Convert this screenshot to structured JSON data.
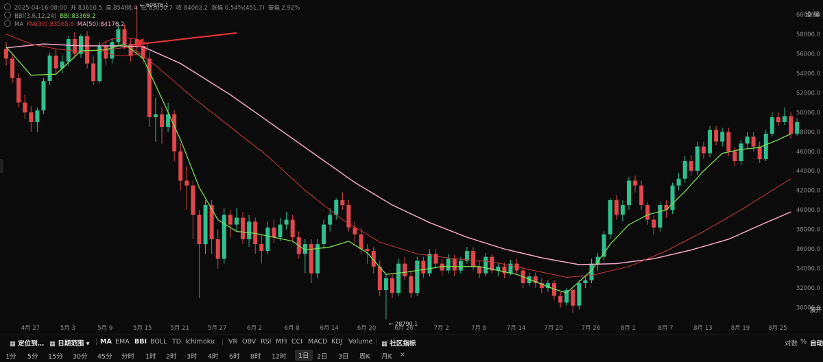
{
  "info": {
    "line1": {
      "time": "2025-04-16 08:00",
      "open": "开 83610.5",
      "high": "高 85488.4",
      "low": "低 83050.7",
      "close": "收 84062.2",
      "change": "涨幅 0.54%(451.7)",
      "amplitude": "振幅 2.92%"
    },
    "line2": {
      "name": "BBI(3,6,12,24)",
      "value": "BBI:83369.2"
    },
    "line3": {
      "name": "MA",
      "ma30": "MA(30):83565.6",
      "ma50": "MA(50):84176.2"
    }
  },
  "topright": "设 编",
  "expand_label": "展开",
  "colors": {
    "up": "#2fbf8f",
    "down": "#e0474c",
    "bbi": "#7fe054",
    "ma30": "#d03a3a",
    "ma50": "#f2a8c8",
    "arrow": "#e23333"
  },
  "chart_data": {
    "type": "candlestick",
    "ylim": [
      28500,
      61500
    ],
    "yticks": [
      "30000.0",
      "32000.0",
      "34000.0",
      "36000.0",
      "38000.0",
      "40000.0",
      "42000.0",
      "44000.0",
      "46000.0",
      "48000.0",
      "50000.0",
      "52000.0",
      "54000.0",
      "56000.0",
      "58000.0",
      "60000.0"
    ],
    "xticks": [
      {
        "label": "4月 27",
        "i": 4
      },
      {
        "label": "5月 3",
        "i": 10
      },
      {
        "label": "5月 9",
        "i": 16
      },
      {
        "label": "5月 15",
        "i": 22
      },
      {
        "label": "5月 21",
        "i": 28
      },
      {
        "label": "5月 27",
        "i": 34
      },
      {
        "label": "6月 2",
        "i": 40
      },
      {
        "label": "6月 8",
        "i": 46
      },
      {
        "label": "6月 14",
        "i": 52
      },
      {
        "label": "6月 20",
        "i": 58
      },
      {
        "label": "6月 26",
        "i": 64
      },
      {
        "label": "7月 2",
        "i": 70
      },
      {
        "label": "7月 8",
        "i": 76
      },
      {
        "label": "7月 14",
        "i": 82
      },
      {
        "label": "7月 20",
        "i": 88
      },
      {
        "label": "7月 26",
        "i": 94
      },
      {
        "label": "8月 1",
        "i": 100
      },
      {
        "label": "8月 7",
        "i": 106
      },
      {
        "label": "8月 13",
        "i": 112
      },
      {
        "label": "8月 19",
        "i": 118
      },
      {
        "label": "8月 25",
        "i": 124
      }
    ],
    "annotations": [
      {
        "text": "60876.1",
        "i": 21,
        "value": 60876.1,
        "kind": "high"
      },
      {
        "text": "28790.1",
        "i": 61,
        "value": 28790.1,
        "kind": "low"
      }
    ],
    "candles": [
      [
        56500,
        55500,
        57200,
        54800
      ],
      [
        55500,
        53500,
        56000,
        53000
      ],
      [
        53500,
        51000,
        54000,
        50500
      ],
      [
        51000,
        50000,
        51800,
        49300
      ],
      [
        50000,
        49000,
        50600,
        48000
      ],
      [
        49000,
        50200,
        50500,
        48000
      ],
      [
        50200,
        53200,
        53500,
        49800
      ],
      [
        53200,
        55800,
        56100,
        52800
      ],
      [
        55800,
        54500,
        56500,
        54000
      ],
      [
        54500,
        55200,
        55800,
        54000
      ],
      [
        55200,
        57500,
        57800,
        54800
      ],
      [
        57500,
        56000,
        58200,
        55500
      ],
      [
        56000,
        57800,
        58000,
        55600
      ],
      [
        57800,
        55000,
        58300,
        54500
      ],
      [
        55000,
        53200,
        55800,
        52800
      ],
      [
        53200,
        56800,
        57200,
        53000
      ],
      [
        56800,
        55500,
        57200,
        54800
      ],
      [
        55500,
        57200,
        57600,
        55000
      ],
      [
        57200,
        58500,
        59200,
        56800
      ],
      [
        58500,
        57000,
        59000,
        56500
      ],
      [
        57000,
        55800,
        57600,
        55200
      ],
      [
        57500,
        56800,
        60876,
        56000
      ],
      [
        56800,
        55500,
        57200,
        55000
      ],
      [
        55500,
        49500,
        56200,
        48500
      ],
      [
        49500,
        49800,
        51500,
        47000
      ],
      [
        49800,
        48500,
        50500,
        46800
      ],
      [
        48500,
        49800,
        51000,
        48000
      ],
      [
        49800,
        46000,
        50200,
        45000
      ],
      [
        46000,
        43000,
        46800,
        42000
      ],
      [
        43000,
        42500,
        44500,
        40000
      ],
      [
        42500,
        39500,
        43000,
        37000
      ],
      [
        39500,
        36500,
        40000,
        31000
      ],
      [
        36500,
        40500,
        41000,
        35500
      ],
      [
        40500,
        37000,
        41000,
        35500
      ],
      [
        37000,
        35000,
        38000,
        34000
      ],
      [
        35000,
        39500,
        40200,
        34500
      ],
      [
        39500,
        38500,
        40000,
        37200
      ],
      [
        38500,
        39200,
        40200,
        37800
      ],
      [
        39200,
        37000,
        39800,
        36500
      ],
      [
        37000,
        38800,
        39500,
        36200
      ],
      [
        38800,
        36500,
        39200,
        35500
      ],
      [
        36500,
        35800,
        37500,
        34500
      ],
      [
        35800,
        38200,
        38800,
        35500
      ],
      [
        38200,
        37200,
        39000,
        36600
      ],
      [
        37200,
        38500,
        39200,
        36800
      ],
      [
        38500,
        39000,
        39800,
        38000
      ],
      [
        39000,
        37200,
        39500,
        36800
      ],
      [
        37200,
        35500,
        37800,
        35000
      ],
      [
        35500,
        36500,
        37000,
        33500
      ],
      [
        36500,
        33500,
        37000,
        32500
      ],
      [
        33500,
        36500,
        37000,
        33000
      ],
      [
        36500,
        38500,
        39000,
        36000
      ],
      [
        38500,
        39500,
        40200,
        37800
      ],
      [
        39500,
        41000,
        41200,
        39000
      ],
      [
        41000,
        40500,
        41800,
        40000
      ],
      [
        40500,
        38200,
        41000,
        37800
      ],
      [
        38200,
        37500,
        38800,
        36500
      ],
      [
        37500,
        36000,
        38200,
        35500
      ],
      [
        36000,
        35800,
        36500,
        34500
      ],
      [
        35800,
        34200,
        36200,
        33500
      ],
      [
        34200,
        31800,
        34800,
        31200
      ],
      [
        31800,
        33000,
        33500,
        28790
      ],
      [
        33000,
        31500,
        33400,
        31000
      ],
      [
        31500,
        34500,
        35000,
        31200
      ],
      [
        34500,
        33200,
        35200,
        32800
      ],
      [
        33200,
        31500,
        33800,
        31000
      ],
      [
        31500,
        34800,
        35200,
        31200
      ],
      [
        34800,
        33500,
        35200,
        33000
      ],
      [
        33500,
        35500,
        36000,
        33200
      ],
      [
        35500,
        34500,
        36000,
        34000
      ],
      [
        34500,
        33800,
        35000,
        33200
      ],
      [
        33800,
        35000,
        35500,
        33500
      ],
      [
        35000,
        33800,
        35400,
        33200
      ],
      [
        33800,
        34800,
        35200,
        33500
      ],
      [
        34800,
        35800,
        36200,
        34500
      ],
      [
        35800,
        34200,
        36200,
        33800
      ],
      [
        34200,
        33500,
        34800,
        33000
      ],
      [
        33500,
        35200,
        35600,
        33200
      ],
      [
        35200,
        33800,
        35500,
        33500
      ],
      [
        33800,
        34200,
        34600,
        33200
      ],
      [
        34200,
        33500,
        34600,
        33000
      ],
      [
        33500,
        34500,
        34900,
        33300
      ],
      [
        34500,
        33800,
        35000,
        33500
      ],
      [
        33800,
        32500,
        34200,
        32000
      ],
      [
        32500,
        33200,
        33600,
        32200
      ],
      [
        33200,
        32500,
        33600,
        32000
      ],
      [
        32500,
        32000,
        33000,
        31500
      ],
      [
        32000,
        32500,
        32800,
        31600
      ],
      [
        32500,
        31200,
        32800,
        30800
      ],
      [
        31200,
        30500,
        31600,
        30000
      ],
      [
        30500,
        31800,
        32000,
        30200
      ],
      [
        31800,
        30200,
        32000,
        29500
      ],
      [
        30200,
        32500,
        32800,
        29800
      ],
      [
        32500,
        32800,
        33200,
        32000
      ],
      [
        32800,
        34500,
        35000,
        32500
      ],
      [
        34500,
        35200,
        35600,
        33800
      ],
      [
        35200,
        37500,
        37800,
        34800
      ],
      [
        37500,
        41000,
        41200,
        37000
      ],
      [
        41000,
        39500,
        41500,
        39000
      ],
      [
        39500,
        40500,
        41000,
        38800
      ],
      [
        40500,
        43000,
        43400,
        40000
      ],
      [
        43000,
        42500,
        43500,
        41800
      ],
      [
        42500,
        40500,
        43000,
        40000
      ],
      [
        40500,
        39000,
        40800,
        38500
      ],
      [
        39000,
        38200,
        39400,
        37500
      ],
      [
        38200,
        40500,
        40800,
        37800
      ],
      [
        40500,
        40000,
        41000,
        39200
      ],
      [
        40000,
        42500,
        42800,
        39600
      ],
      [
        42500,
        43200,
        43800,
        42000
      ],
      [
        43200,
        45000,
        45500,
        42800
      ],
      [
        45000,
        44000,
        45600,
        43500
      ],
      [
        44000,
        46500,
        47000,
        43600
      ],
      [
        46500,
        45800,
        47000,
        45200
      ],
      [
        45800,
        48200,
        48600,
        45400
      ],
      [
        48200,
        47000,
        48600,
        46600
      ],
      [
        47000,
        48000,
        48400,
        46500
      ],
      [
        48000,
        46000,
        48400,
        45500
      ],
      [
        46000,
        45000,
        46400,
        44500
      ],
      [
        45000,
        46800,
        47200,
        44600
      ],
      [
        46800,
        47500,
        48000,
        46300
      ],
      [
        47500,
        46500,
        48000,
        46000
      ],
      [
        46500,
        45200,
        47000,
        44800
      ],
      [
        45200,
        47800,
        48200,
        45000
      ],
      [
        47800,
        49500,
        50000,
        47500
      ],
      [
        49500,
        49000,
        50000,
        48600
      ],
      [
        49000,
        49600,
        50500,
        48700
      ],
      [
        49600,
        47800,
        50000,
        47300
      ],
      [
        47800,
        49000,
        49400,
        47600
      ]
    ],
    "bbi": [
      [
        0,
        56700
      ],
      [
        4,
        53800
      ],
      [
        8,
        53900
      ],
      [
        12,
        56300
      ],
      [
        16,
        56400
      ],
      [
        19,
        57000
      ],
      [
        22,
        55500
      ],
      [
        25,
        51400
      ],
      [
        28,
        47200
      ],
      [
        31,
        42300
      ],
      [
        34,
        39000
      ],
      [
        37,
        37800
      ],
      [
        40,
        37600
      ],
      [
        43,
        37200
      ],
      [
        46,
        36800
      ],
      [
        48,
        35900
      ],
      [
        52,
        36200
      ],
      [
        55,
        36800
      ],
      [
        58,
        35600
      ],
      [
        61,
        33400
      ],
      [
        64,
        33600
      ],
      [
        70,
        34200
      ],
      [
        76,
        34200
      ],
      [
        82,
        33400
      ],
      [
        88,
        31900
      ],
      [
        90,
        31500
      ],
      [
        94,
        33800
      ],
      [
        97,
        36500
      ],
      [
        100,
        38500
      ],
      [
        103,
        39500
      ],
      [
        106,
        40000
      ],
      [
        109,
        41900
      ],
      [
        112,
        44000
      ],
      [
        115,
        45800
      ],
      [
        118,
        46200
      ],
      [
        121,
        46400
      ],
      [
        124,
        47200
      ],
      [
        126,
        47800
      ]
    ],
    "ma30": [
      [
        0,
        58000
      ],
      [
        4,
        57000
      ],
      [
        8,
        56500
      ],
      [
        12,
        56200
      ],
      [
        16,
        56400
      ],
      [
        20,
        56700
      ],
      [
        24,
        54800
      ],
      [
        30,
        51500
      ],
      [
        36,
        48500
      ],
      [
        42,
        45500
      ],
      [
        48,
        42000
      ],
      [
        54,
        39000
      ],
      [
        60,
        36700
      ],
      [
        66,
        35500
      ],
      [
        72,
        35000
      ],
      [
        78,
        34700
      ],
      [
        84,
        33900
      ],
      [
        90,
        33100
      ],
      [
        94,
        33300
      ],
      [
        100,
        34200
      ],
      [
        106,
        35800
      ],
      [
        112,
        37800
      ],
      [
        118,
        40000
      ],
      [
        124,
        42400
      ],
      [
        126,
        43200
      ]
    ],
    "ma50": [
      [
        0,
        56600
      ],
      [
        6,
        57000
      ],
      [
        12,
        56800
      ],
      [
        18,
        56800
      ],
      [
        22,
        56700
      ],
      [
        28,
        55000
      ],
      [
        36,
        51800
      ],
      [
        44,
        48200
      ],
      [
        50,
        45500
      ],
      [
        56,
        42800
      ],
      [
        62,
        40500
      ],
      [
        68,
        38700
      ],
      [
        74,
        37200
      ],
      [
        80,
        36000
      ],
      [
        86,
        35100
      ],
      [
        92,
        34400
      ],
      [
        98,
        34500
      ],
      [
        104,
        35000
      ],
      [
        110,
        35900
      ],
      [
        116,
        37000
      ],
      [
        122,
        38700
      ],
      [
        126,
        39800
      ]
    ]
  },
  "toolbar1": {
    "locate": "定位到…",
    "range": "日期范围",
    "indicators": [
      "MA",
      "EMA",
      "BBI",
      "BOLL",
      "TD",
      "Ichimoku"
    ],
    "sub_indicators": [
      "VR",
      "OBV",
      "RSI",
      "MFI",
      "CCI",
      "MACD",
      "KDJ",
      "Volume"
    ],
    "community": "社区指标",
    "right": [
      "对数",
      "%",
      "自动"
    ]
  },
  "toolbar2": {
    "periods": [
      "1分",
      "5分",
      "15分",
      "30分",
      "45分",
      "分时",
      "1时",
      "2时",
      "3时",
      "4时",
      "6时",
      "8时",
      "12时",
      "1日",
      "2日",
      "3日",
      "周K",
      "月K"
    ],
    "active": "1日",
    "close": "×"
  }
}
